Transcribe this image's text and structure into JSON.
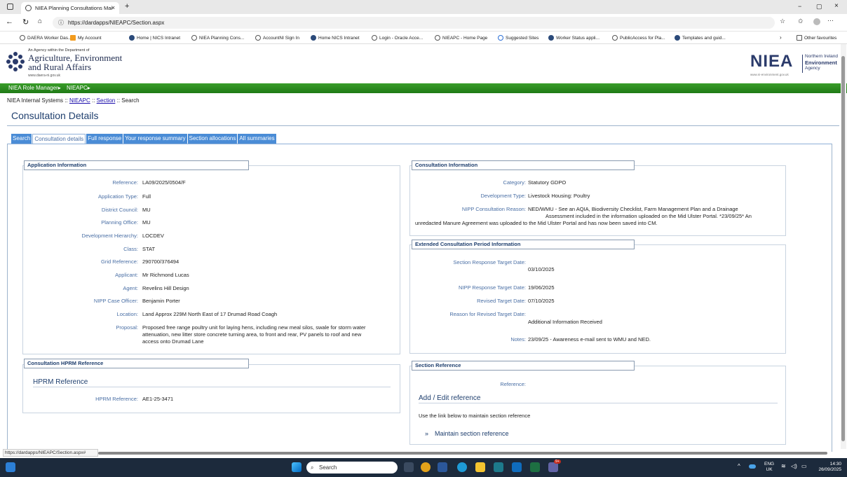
{
  "browser": {
    "tab_title": "NIEA Planning Consultations Mai",
    "tab_close": "×",
    "new_tab": "+",
    "url": "https://dardapps/NIEAPC/Section.aspx",
    "window_controls": [
      "−",
      "▢",
      "×"
    ],
    "favourites": [
      "DAERA Worker Das...",
      "My Account",
      "Home | NICS Intranet",
      "NIEA Planning Cons...",
      "AccountNI Sign In",
      "Home NICS Intranet",
      "Login - Oracle Acce...",
      "NIEAPC - Home Page",
      "Suggested Sites",
      "Worker Status appli...",
      "PublicAccess for Pla...",
      "Templates and guid..."
    ],
    "other_favourites": "Other favourites",
    "status_url": "https://dardapps/NIEAPC/Section.aspx#"
  },
  "header": {
    "agency_line": "An Agency within the Department of",
    "dept_line1": "Agriculture, Environment",
    "dept_line2": "and Rural Affairs",
    "dept_url": "www.daera-ni.gov.uk",
    "niea_logo": "NIEA",
    "niea_line1": "Northern Ireland",
    "niea_line2": "Environment",
    "niea_line3": "Agency",
    "niea_url": "www.ni-environment.gov.uk"
  },
  "nav": {
    "role_manager": "NIEA Role Manager▸",
    "nieapc": "NIEAPC▸"
  },
  "breadcrumb": {
    "root": "NIEA Internal Systems",
    "sep": "::",
    "link1": "NIEAPC",
    "link2": "Section",
    "current": "Search"
  },
  "page_title": "Consultation Details",
  "tabs": [
    "Search",
    "Consultation details",
    "Full response",
    "Your response summary",
    "Section allocations",
    "All summaries"
  ],
  "application": {
    "heading": "Application Information",
    "rows": [
      {
        "label": "Reference:",
        "value": "LA09/2025/0504/F"
      },
      {
        "label": "Application Type:",
        "value": "Full"
      },
      {
        "label": "District Council:",
        "value": "MU"
      },
      {
        "label": "Planning Office:",
        "value": "MU"
      },
      {
        "label": "Development Hierarchy:",
        "value": "LOCDEV"
      },
      {
        "label": "Class:",
        "value": "STAT"
      },
      {
        "label": "Grid Reference:",
        "value": "290700/376494"
      },
      {
        "label": "Applicant:",
        "value": "Mr Richmond Lucas"
      },
      {
        "label": "Agent:",
        "value": "Revelins Hill Design"
      },
      {
        "label": "NIPP Case Officer:",
        "value": "Benjamin Porter"
      },
      {
        "label": "Location:",
        "value": "Land Approx 229M North East of 17 Drumad Road Coagh"
      }
    ],
    "proposal_label": "Proposal:",
    "proposal_value": "Proposed free range poultry unit for laying hens, including new meal silos, swale for storm water attenuation, new litter store concrete turning area, to front and rear, PV panels to roof and new access onto Drumad Lane"
  },
  "hprm": {
    "heading": "Consultation HPRM Reference",
    "subheading": "HPRM Reference",
    "label": "HPRM Reference:",
    "value": "AE1-25-3471"
  },
  "consultation": {
    "heading": "Consultation Information",
    "category_label": "Category:",
    "category_value": "Statutory GDPO",
    "devtype_label": "Development Type:",
    "devtype_value": "Livestock Housing: Poultry",
    "reason_label": "NIPP Consultation Reason:",
    "reason_line1": "NED/WMU - See an AQIA, Biodiversity Checklist, Farm Management Plan and a Drainage",
    "reason_line2": "Assessment included in the information uploaded on the Mid Ulster Portal. *23/09/25* An",
    "reason_line3": "unredacted Manure Agreement was uploaded to the Mid Ulster Portal and has now been saved into CM."
  },
  "extended": {
    "heading": "Extended Consultation Period Information",
    "section_target_label": "Section Response Target Date:",
    "section_target_value": "03/10/2025",
    "nipp_target_label": "NIPP Response Target Date:",
    "nipp_target_value": "19/06/2025",
    "revised_label": "Revised Target Date:",
    "revised_value": "07/10/2025",
    "reason_label": "Reason for Revised Target Date:",
    "reason_value": "Additional Information Received",
    "notes_label": "Notes:",
    "notes_value": "23/09/25 - Awareness e-mail sent to WMU and NED."
  },
  "section_ref": {
    "heading": "Section Reference",
    "label": "Reference:",
    "value": "",
    "subheading": "Add / Edit reference",
    "instruction": "Use the link below to maintain section reference",
    "link_arrow": "»",
    "link": "Maintain section reference"
  },
  "taskbar": {
    "search": "Search",
    "lang1": "ENG",
    "lang2": "UK",
    "time": "14:30",
    "date": "26/09/2025",
    "badge": "9+"
  },
  "colors": {
    "nav_green": "#2a8a1f",
    "tab_blue": "#4a8cd6",
    "label_blue": "#4a6fa5",
    "heading_navy": "#1f3f6e",
    "taskbar": "#1c2a3c"
  }
}
